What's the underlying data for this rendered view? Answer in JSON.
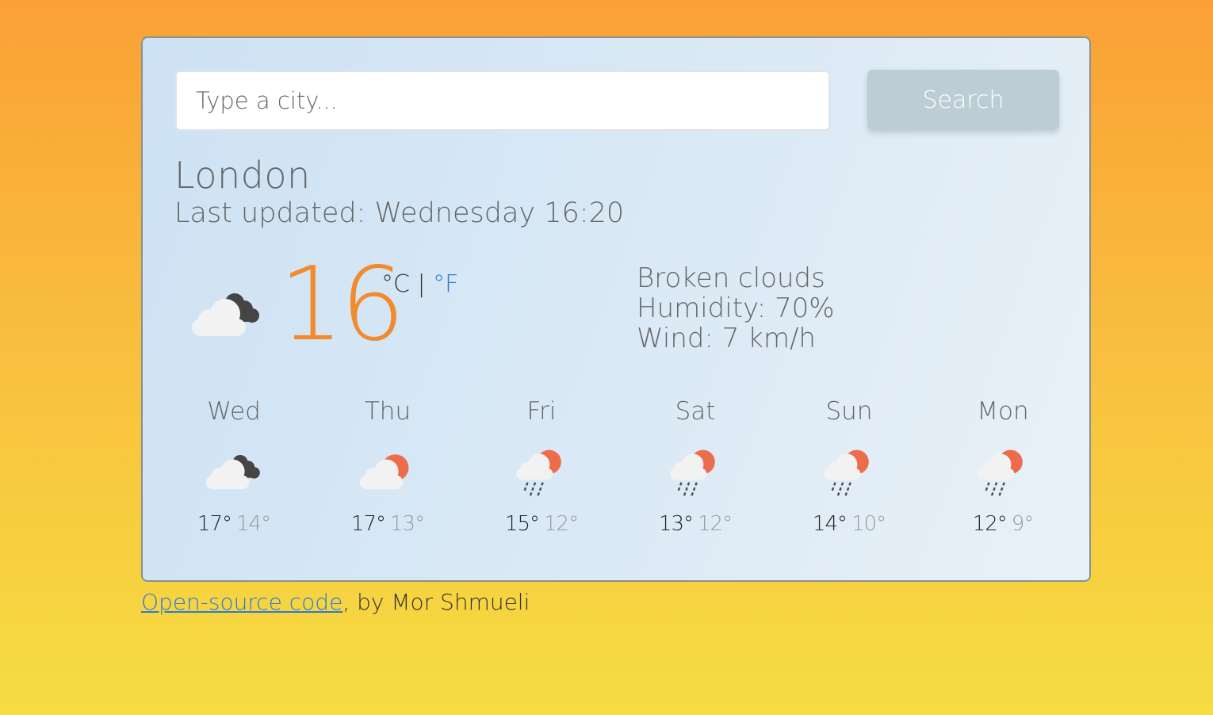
{
  "search": {
    "placeholder": "Type a city...",
    "button_label": "Search"
  },
  "current": {
    "city": "London",
    "last_updated": "Last updated: Wednesday 16:20",
    "icon": "cloudy-icon",
    "temperature": "16",
    "unit_celsius": "°C",
    "unit_separator": "|",
    "unit_fahrenheit": "°F",
    "description": "Broken clouds",
    "humidity": "Humidity: 70%",
    "wind": "Wind: 7 km/h"
  },
  "forecast": [
    {
      "day": "Wed",
      "icon": "cloudy-icon",
      "max": "17°",
      "min": "14°"
    },
    {
      "day": "Thu",
      "icon": "partly-cloudy-icon",
      "max": "17°",
      "min": "13°"
    },
    {
      "day": "Fri",
      "icon": "rain-sun-icon",
      "max": "15°",
      "min": "12°"
    },
    {
      "day": "Sat",
      "icon": "rain-sun-icon",
      "max": "13°",
      "min": "12°"
    },
    {
      "day": "Sun",
      "icon": "rain-sun-icon",
      "max": "14°",
      "min": "10°"
    },
    {
      "day": "Mon",
      "icon": "rain-sun-icon",
      "max": "12°",
      "min": "9°"
    }
  ],
  "footer": {
    "link_text": "Open-source code",
    "credit": ", by Mor Shmueli"
  },
  "colors": {
    "accent_temp": "#f28a2e",
    "link": "#2b7bd6",
    "sun": "#ec6c4c"
  }
}
